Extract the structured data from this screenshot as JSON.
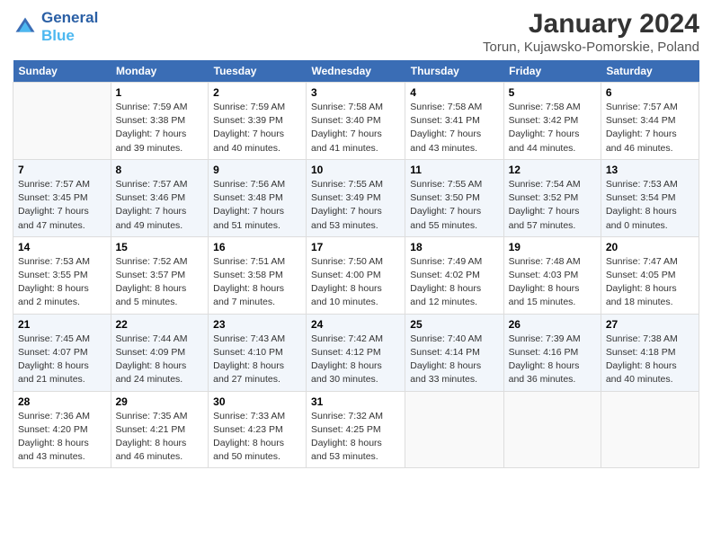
{
  "header": {
    "logo_line1": "General",
    "logo_line2": "Blue",
    "month_title": "January 2024",
    "subtitle": "Torun, Kujawsko-Pomorskie, Poland"
  },
  "weekdays": [
    "Sunday",
    "Monday",
    "Tuesday",
    "Wednesday",
    "Thursday",
    "Friday",
    "Saturday"
  ],
  "weeks": [
    [
      {
        "num": "",
        "info": ""
      },
      {
        "num": "1",
        "info": "Sunrise: 7:59 AM\nSunset: 3:38 PM\nDaylight: 7 hours\nand 39 minutes."
      },
      {
        "num": "2",
        "info": "Sunrise: 7:59 AM\nSunset: 3:39 PM\nDaylight: 7 hours\nand 40 minutes."
      },
      {
        "num": "3",
        "info": "Sunrise: 7:58 AM\nSunset: 3:40 PM\nDaylight: 7 hours\nand 41 minutes."
      },
      {
        "num": "4",
        "info": "Sunrise: 7:58 AM\nSunset: 3:41 PM\nDaylight: 7 hours\nand 43 minutes."
      },
      {
        "num": "5",
        "info": "Sunrise: 7:58 AM\nSunset: 3:42 PM\nDaylight: 7 hours\nand 44 minutes."
      },
      {
        "num": "6",
        "info": "Sunrise: 7:57 AM\nSunset: 3:44 PM\nDaylight: 7 hours\nand 46 minutes."
      }
    ],
    [
      {
        "num": "7",
        "info": "Sunrise: 7:57 AM\nSunset: 3:45 PM\nDaylight: 7 hours\nand 47 minutes."
      },
      {
        "num": "8",
        "info": "Sunrise: 7:57 AM\nSunset: 3:46 PM\nDaylight: 7 hours\nand 49 minutes."
      },
      {
        "num": "9",
        "info": "Sunrise: 7:56 AM\nSunset: 3:48 PM\nDaylight: 7 hours\nand 51 minutes."
      },
      {
        "num": "10",
        "info": "Sunrise: 7:55 AM\nSunset: 3:49 PM\nDaylight: 7 hours\nand 53 minutes."
      },
      {
        "num": "11",
        "info": "Sunrise: 7:55 AM\nSunset: 3:50 PM\nDaylight: 7 hours\nand 55 minutes."
      },
      {
        "num": "12",
        "info": "Sunrise: 7:54 AM\nSunset: 3:52 PM\nDaylight: 7 hours\nand 57 minutes."
      },
      {
        "num": "13",
        "info": "Sunrise: 7:53 AM\nSunset: 3:54 PM\nDaylight: 8 hours\nand 0 minutes."
      }
    ],
    [
      {
        "num": "14",
        "info": "Sunrise: 7:53 AM\nSunset: 3:55 PM\nDaylight: 8 hours\nand 2 minutes."
      },
      {
        "num": "15",
        "info": "Sunrise: 7:52 AM\nSunset: 3:57 PM\nDaylight: 8 hours\nand 5 minutes."
      },
      {
        "num": "16",
        "info": "Sunrise: 7:51 AM\nSunset: 3:58 PM\nDaylight: 8 hours\nand 7 minutes."
      },
      {
        "num": "17",
        "info": "Sunrise: 7:50 AM\nSunset: 4:00 PM\nDaylight: 8 hours\nand 10 minutes."
      },
      {
        "num": "18",
        "info": "Sunrise: 7:49 AM\nSunset: 4:02 PM\nDaylight: 8 hours\nand 12 minutes."
      },
      {
        "num": "19",
        "info": "Sunrise: 7:48 AM\nSunset: 4:03 PM\nDaylight: 8 hours\nand 15 minutes."
      },
      {
        "num": "20",
        "info": "Sunrise: 7:47 AM\nSunset: 4:05 PM\nDaylight: 8 hours\nand 18 minutes."
      }
    ],
    [
      {
        "num": "21",
        "info": "Sunrise: 7:45 AM\nSunset: 4:07 PM\nDaylight: 8 hours\nand 21 minutes."
      },
      {
        "num": "22",
        "info": "Sunrise: 7:44 AM\nSunset: 4:09 PM\nDaylight: 8 hours\nand 24 minutes."
      },
      {
        "num": "23",
        "info": "Sunrise: 7:43 AM\nSunset: 4:10 PM\nDaylight: 8 hours\nand 27 minutes."
      },
      {
        "num": "24",
        "info": "Sunrise: 7:42 AM\nSunset: 4:12 PM\nDaylight: 8 hours\nand 30 minutes."
      },
      {
        "num": "25",
        "info": "Sunrise: 7:40 AM\nSunset: 4:14 PM\nDaylight: 8 hours\nand 33 minutes."
      },
      {
        "num": "26",
        "info": "Sunrise: 7:39 AM\nSunset: 4:16 PM\nDaylight: 8 hours\nand 36 minutes."
      },
      {
        "num": "27",
        "info": "Sunrise: 7:38 AM\nSunset: 4:18 PM\nDaylight: 8 hours\nand 40 minutes."
      }
    ],
    [
      {
        "num": "28",
        "info": "Sunrise: 7:36 AM\nSunset: 4:20 PM\nDaylight: 8 hours\nand 43 minutes."
      },
      {
        "num": "29",
        "info": "Sunrise: 7:35 AM\nSunset: 4:21 PM\nDaylight: 8 hours\nand 46 minutes."
      },
      {
        "num": "30",
        "info": "Sunrise: 7:33 AM\nSunset: 4:23 PM\nDaylight: 8 hours\nand 50 minutes."
      },
      {
        "num": "31",
        "info": "Sunrise: 7:32 AM\nSunset: 4:25 PM\nDaylight: 8 hours\nand 53 minutes."
      },
      {
        "num": "",
        "info": ""
      },
      {
        "num": "",
        "info": ""
      },
      {
        "num": "",
        "info": ""
      }
    ]
  ]
}
